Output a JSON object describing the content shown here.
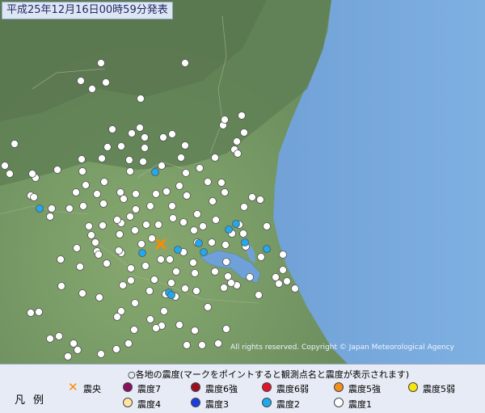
{
  "header": {
    "timestamp": "平成25年12月16日00時59分発表"
  },
  "map": {
    "copyright": "All rights reserved. Copyright © Japan Meteorological Agency"
  },
  "legend": {
    "title": "凡例",
    "caption": "○各地の震度(マークをポイントすると観測点名と震度が表示されます)",
    "epicenter_label": "震央",
    "intensities": [
      {
        "label": "震度7",
        "color": "#8b1060"
      },
      {
        "label": "震度6強",
        "color": "#9b1020"
      },
      {
        "label": "震度6弱",
        "color": "#e2142a"
      },
      {
        "label": "震度5強",
        "color": "#f38f1e"
      },
      {
        "label": "震度5弱",
        "color": "#f5e60c"
      },
      {
        "label": "震度4",
        "color": "#ffe6a0"
      },
      {
        "label": "震度3",
        "color": "#1c3dde"
      },
      {
        "label": "震度2",
        "color": "#21a9f0"
      },
      {
        "label": "震度1",
        "color": "#ffffff"
      }
    ]
  },
  "colors": {
    "sea": "#6fa1d8",
    "land": "#6d8f5f",
    "mountain": "#5f7f55",
    "lake": "#6fa1d8",
    "epicenter": "#ff8a00"
  },
  "stations": {
    "intensity_1_count": 170,
    "intensity_2_count": 12
  }
}
